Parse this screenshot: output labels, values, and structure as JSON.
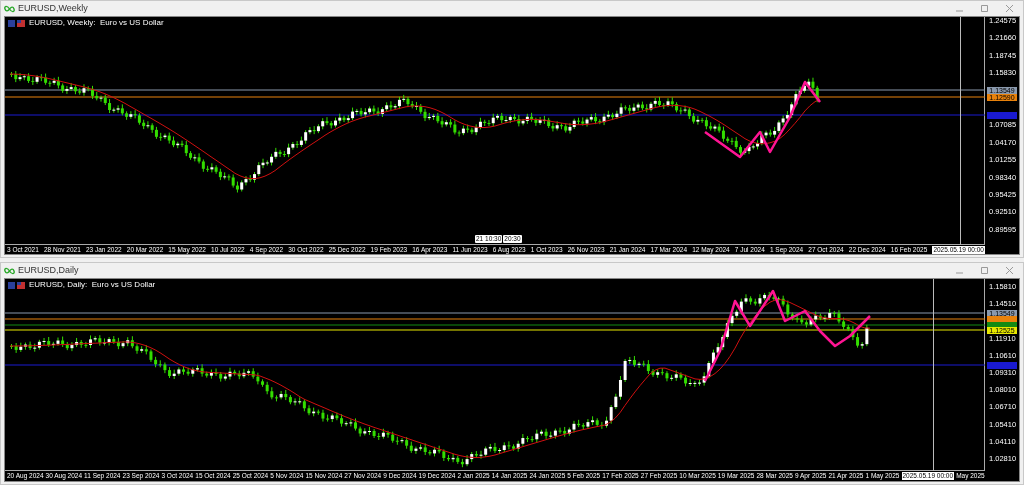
{
  "windows": [
    {
      "kind": "weekly",
      "title": "EURUSD,Weekly",
      "chart_label": "EURUSD, Weekly:  Euro vs US Dollar",
      "price_axis": [
        "1.24575",
        "1.21660",
        "1.18745",
        "1.15830",
        "1.07085",
        "1.04170",
        "1.01255",
        "0.98340",
        "0.95425",
        "0.92510",
        "0.89595"
      ],
      "price_tags": [
        {
          "text": "1.13549",
          "color": "#8a99ad"
        },
        {
          "text": "1.12590",
          "color": "#e8820c"
        },
        {
          "color": "#1a1ad0"
        }
      ],
      "time_axis": [
        "3 Oct 2021",
        "28 Nov 2021",
        "23 Jan 2022",
        "20 Mar 2022",
        "15 May 2022",
        "10 Jul 2022",
        "4 Sep 2022",
        "30 Oct 2022",
        "25 Dec 2022",
        "19 Feb 2023",
        "16 Apr 2023",
        "11 Jun 2023",
        "6 Aug 2023",
        "1 Oct 2023",
        "26 Nov 2023",
        "21 Jan 2024",
        "17 Mar 2024",
        "12 May 2024",
        "7 Jul 2024",
        "1 Sep 2024",
        "27 Oct 2024",
        "22 Dec 2024",
        "16 Feb 2025"
      ],
      "markers": [
        "21 10:30",
        "20:30"
      ],
      "cursor_time": "2025.05.19 00:00"
    },
    {
      "kind": "daily",
      "title": "EURUSD,Daily",
      "chart_label": "EURUSD, Daily:  Euro vs US Dollar",
      "price_axis": [
        "1.15810",
        "1.14510",
        "1.11910",
        "1.10610",
        "1.09310",
        "1.08010",
        "1.06710",
        "1.05410",
        "1.04110",
        "1.02810"
      ],
      "price_tags": [
        {
          "text": "1.13549",
          "color": "#8a99ad"
        },
        {
          "color": "#e8820c"
        },
        {
          "color": "#138a13"
        },
        {
          "text": "1.12525",
          "color": "#e8e800"
        },
        {
          "color": "#1a1ad0"
        }
      ],
      "time_axis": [
        "20 Aug 2024",
        "30 Aug 2024",
        "11 Sep 2024",
        "23 Sep 2024",
        "3 Oct 2024",
        "15 Oct 2024",
        "25 Oct 2024",
        "5 Nov 2024",
        "15 Nov 2024",
        "27 Nov 2024",
        "9 Dec 2024",
        "19 Dec 2024",
        "2 Jan 2025",
        "14 Jan 2025",
        "24 Jan 2025",
        "5 Feb 2025",
        "17 Feb 2025",
        "27 Feb 2025",
        "10 Mar 2025",
        "19 Mar 2025",
        "28 Mar 2025",
        "9 Apr 2025",
        "21 Apr 2025",
        "1 May 2025",
        "May 2025"
      ],
      "cursor_time": "2025.05.19 00:00"
    }
  ]
}
